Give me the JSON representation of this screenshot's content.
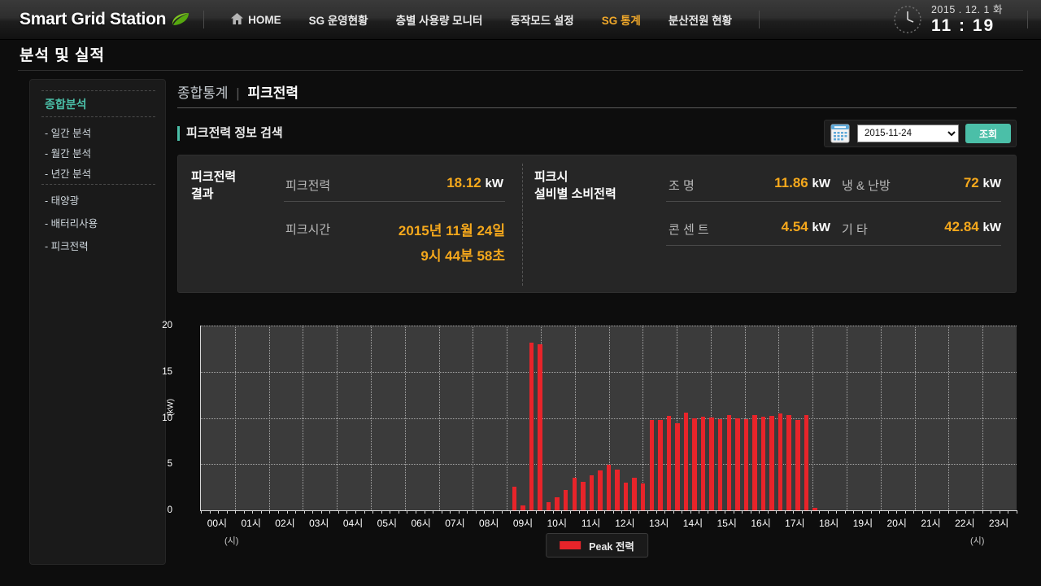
{
  "topnav": {
    "brand": "Smart Grid Station",
    "items": [
      {
        "label": "HOME",
        "icon": "home-icon",
        "active": false
      },
      {
        "label": "SG 운영현황",
        "active": false
      },
      {
        "label": "층별 사용량 모니터",
        "active": false
      },
      {
        "label": "동작모드 설정",
        "active": false
      },
      {
        "label": "SG 통계",
        "active": true
      },
      {
        "label": "분산전원 현황",
        "active": false
      }
    ],
    "clock": {
      "date": "2015 . 12.  1  화",
      "time": "11  :  19",
      "icon": "clock-icon"
    },
    "accent": "#f0a82a"
  },
  "page": {
    "title": "분석 및 실적"
  },
  "sidebar": {
    "heading": "종합분석",
    "items": [
      {
        "label": "- 일간 분석"
      },
      {
        "label": "- 월간 분석"
      },
      {
        "label": "- 년간 분석"
      },
      {
        "label": "- 태양광"
      },
      {
        "label": "- 배터리사용"
      },
      {
        "label": "- 피크전력"
      }
    ]
  },
  "breadcrumb": {
    "parent": "종합통계",
    "sep": "|",
    "current": "피크전력"
  },
  "search": {
    "label": "피크전력 정보 검색",
    "calendar_icon": "calendar-icon",
    "date_value": "2015-11-24",
    "date_options": [
      "2015-11-24"
    ],
    "button_label": "조회",
    "button_color": "#4bbfa8"
  },
  "results": {
    "left": {
      "title_line1": "피크전력",
      "title_line2": "결과",
      "rows": [
        {
          "label": "피크전력",
          "value": "18.12",
          "unit": "kW"
        },
        {
          "label": "피크시간",
          "value": "2015년 11월 24일",
          "value2": "9시 44분 58초",
          "unit": ""
        }
      ]
    },
    "right": {
      "title_line1": "피크시",
      "title_line2": "설비별 소비전력",
      "rows": [
        {
          "label": "조      명",
          "value": "11.86",
          "unit": "kW",
          "label2": "냉 & 난방",
          "value2": "72",
          "unit2": "kW"
        },
        {
          "label": "콘 센 트",
          "value": "4.54",
          "unit": "kW",
          "label2": "기      타",
          "value2": "42.84",
          "unit2": "kW"
        }
      ]
    },
    "value_color": "#f5a81c"
  },
  "chart_data": {
    "type": "bar",
    "title": "",
    "xlabel": "(시)",
    "ylabel": "(kW)",
    "ylim": [
      0,
      20
    ],
    "yticks": [
      0,
      5,
      10,
      15,
      20
    ],
    "grid": true,
    "legend": {
      "position": "bottom-center",
      "entries": [
        {
          "name": "Peak 전력",
          "color": "#e8242a"
        }
      ]
    },
    "bar_color": "#e8242a",
    "xtick_labels": [
      "00시",
      "01시",
      "02시",
      "03시",
      "04시",
      "05시",
      "06시",
      "07시",
      "08시",
      "09시",
      "10시",
      "11시",
      "12시",
      "13시",
      "14시",
      "15시",
      "16시",
      "17시",
      "18시",
      "19시",
      "20시",
      "21시",
      "22시",
      "23시"
    ],
    "interval_minutes": 15,
    "x": [
      "00:00",
      "00:15",
      "00:30",
      "00:45",
      "01:00",
      "01:15",
      "01:30",
      "01:45",
      "02:00",
      "02:15",
      "02:30",
      "02:45",
      "03:00",
      "03:15",
      "03:30",
      "03:45",
      "04:00",
      "04:15",
      "04:30",
      "04:45",
      "05:00",
      "05:15",
      "05:30",
      "05:45",
      "06:00",
      "06:15",
      "06:30",
      "06:45",
      "07:00",
      "07:15",
      "07:30",
      "07:45",
      "08:00",
      "08:15",
      "08:30",
      "08:45",
      "09:00",
      "09:15",
      "09:30",
      "09:45",
      "10:00",
      "10:15",
      "10:30",
      "10:45",
      "11:00",
      "11:15",
      "11:30",
      "11:45",
      "12:00",
      "12:15",
      "12:30",
      "12:45",
      "13:00",
      "13:15",
      "13:30",
      "13:45",
      "14:00",
      "14:15",
      "14:30",
      "14:45",
      "15:00",
      "15:15",
      "15:30",
      "15:45",
      "16:00",
      "16:15",
      "16:30",
      "16:45",
      "17:00",
      "17:15",
      "17:30",
      "17:45",
      "18:00",
      "18:15",
      "18:30",
      "18:45",
      "19:00",
      "19:15",
      "19:30",
      "19:45",
      "20:00",
      "20:15",
      "20:30",
      "20:45",
      "21:00",
      "21:15",
      "21:30",
      "21:45",
      "22:00",
      "22:15",
      "22:30",
      "22:45",
      "23:00",
      "23:15",
      "23:30",
      "23:45"
    ],
    "values": [
      0,
      0,
      0,
      0,
      0,
      0,
      0,
      0,
      0,
      0,
      0,
      0,
      0,
      0,
      0,
      0,
      0,
      0,
      0,
      0,
      0,
      0,
      0,
      0,
      0,
      0,
      0,
      0,
      0,
      0,
      0,
      0,
      0,
      0,
      0,
      0,
      2.6,
      0.55,
      18.12,
      17.95,
      0.85,
      1.4,
      2.2,
      3.55,
      3.1,
      3.75,
      4.35,
      4.95,
      4.45,
      3.0,
      3.55,
      2.9,
      9.75,
      9.8,
      10.2,
      9.45,
      10.55,
      9.95,
      10.1,
      10.05,
      9.85,
      10.3,
      10.0,
      9.9,
      10.35,
      10.15,
      10.25,
      10.45,
      10.3,
      9.8,
      10.35,
      0.3,
      0,
      0,
      0,
      0,
      0,
      0,
      0,
      0,
      0,
      0,
      0,
      0,
      0,
      0,
      0,
      0,
      0,
      0,
      0,
      0,
      0,
      0,
      0
    ],
    "peak_value": 18.12,
    "peak_time": "09:44:58"
  }
}
